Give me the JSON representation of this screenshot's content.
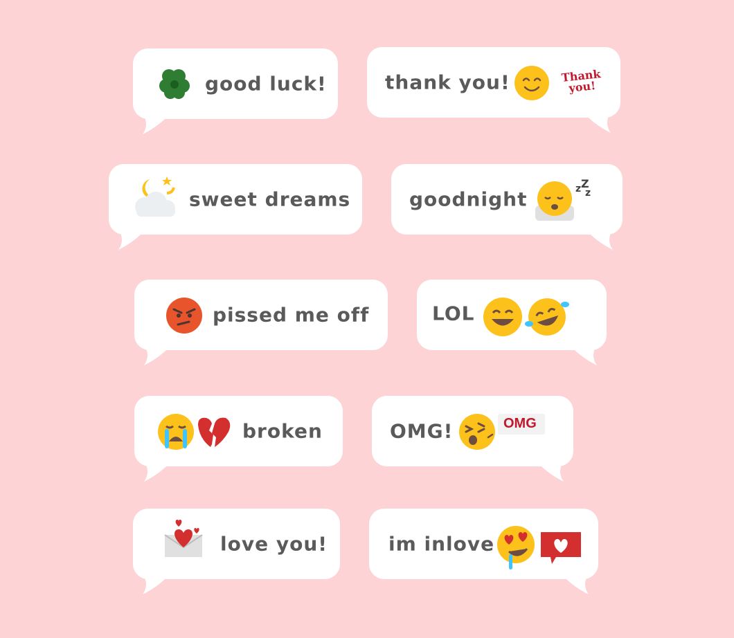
{
  "messages": [
    {
      "text": "good luck!",
      "icon": "four-leaf-clover-icon"
    },
    {
      "text": "thank you!",
      "icon": "smiling-face-icon",
      "sticker": "Thank you!"
    },
    {
      "text": "sweet dreams",
      "icon": "moon-cloud-icon"
    },
    {
      "text": "goodnight",
      "icon": "sleeping-face-icon"
    },
    {
      "text": "pissed me off",
      "icon": "angry-face-icon"
    },
    {
      "text": "LOL",
      "icon": "laughing-faces-icon"
    },
    {
      "text": "broken",
      "icon": "crying-face-broken-heart-icon"
    },
    {
      "text": "OMG!",
      "icon": "shocked-face-icon",
      "sticker": "OMG"
    },
    {
      "text": "love you!",
      "icon": "love-letter-icon"
    },
    {
      "text": "im inlove",
      "icon": "heart-eyes-heart-notification-icon"
    }
  ],
  "colors": {
    "background": "#fdd3d5",
    "bubble": "#ffffff",
    "text": "#5a5a5a",
    "emoji_yellow": "#fcc21b",
    "accent_red": "#c0182c"
  }
}
